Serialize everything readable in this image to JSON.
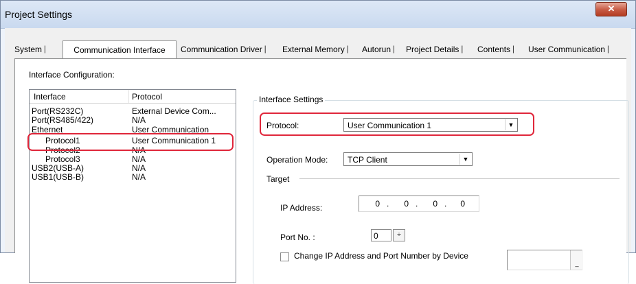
{
  "window": {
    "title": "Project Settings",
    "close_glyph": "✕"
  },
  "tabs": [
    {
      "label": "System"
    },
    {
      "label": "Communication Interface"
    },
    {
      "label": "Communication Driver"
    },
    {
      "label": "External Memory"
    },
    {
      "label": "Autorun"
    },
    {
      "label": "Project Details"
    },
    {
      "label": "Contents"
    },
    {
      "label": "User Communication"
    }
  ],
  "interface_config": {
    "label": "Interface Configuration:",
    "columns": [
      "Interface",
      "Protocol"
    ],
    "rows": [
      {
        "interface": "Port(RS232C)",
        "protocol": "External Device Com..."
      },
      {
        "interface": "Port(RS485/422)",
        "protocol": "N/A"
      },
      {
        "interface": "Ethernet",
        "protocol": "User Communication"
      },
      {
        "interface": "Protocol1",
        "protocol": "User Communication 1"
      },
      {
        "interface": "Protocol2",
        "protocol": "N/A"
      },
      {
        "interface": "Protocol3",
        "protocol": "N/A"
      },
      {
        "interface": "USB2(USB-A)",
        "protocol": "N/A"
      },
      {
        "interface": "USB1(USB-B)",
        "protocol": "N/A"
      }
    ]
  },
  "interface_settings": {
    "title": "Interface Settings",
    "protocol_label": "Protocol:",
    "protocol_value": "User Communication 1",
    "operation_mode_label": "Operation Mode:",
    "operation_mode_value": "TCP Client",
    "target_label": "Target",
    "ip_label": "IP Address:",
    "ip_octets": [
      "0",
      "0",
      "0",
      "0"
    ],
    "port_label": "Port No. :",
    "port_value": "0",
    "change_label": "Change IP Address and Port Number by Device",
    "change_checked": false
  },
  "colors": {
    "highlight": "#e0263a",
    "close": "#c75a43"
  }
}
